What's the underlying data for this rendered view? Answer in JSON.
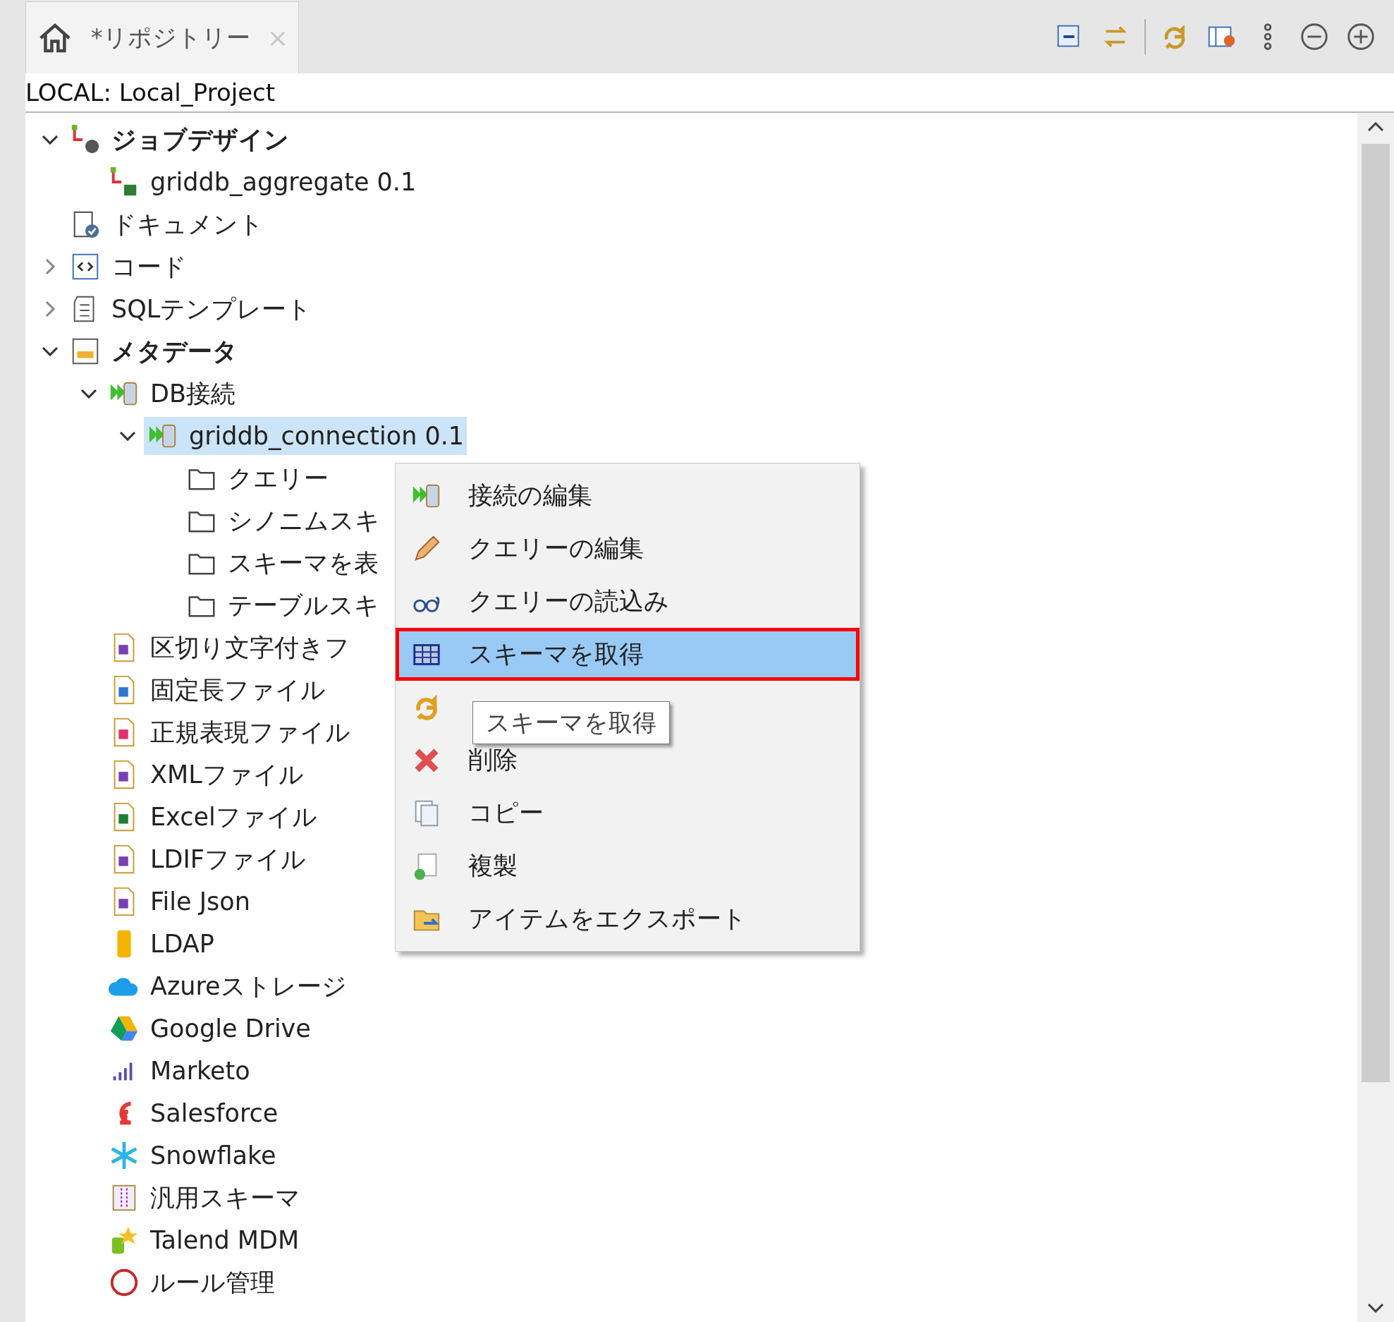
{
  "tab": {
    "title": "*リポジトリー",
    "close": "×"
  },
  "project": "LOCAL: Local_Project",
  "tree": [
    {
      "label": "ジョブデザイン",
      "bold": true,
      "expanded": true,
      "selected": false,
      "children": [
        {
          "label": "griddb_aggregate 0.1",
          "selected": false
        }
      ]
    },
    {
      "label": "ドキュメント",
      "bold": false,
      "selected": false
    },
    {
      "label": "コード",
      "bold": false,
      "expanded": false,
      "selected": false
    },
    {
      "label": "SQLテンプレート",
      "bold": false,
      "expanded": false,
      "selected": false
    },
    {
      "label": "メタデータ",
      "bold": true,
      "expanded": true,
      "selected": false,
      "children": [
        {
          "label": "DB接続",
          "expanded": true,
          "selected": false,
          "children": [
            {
              "label": "griddb_connection 0.1",
              "expanded": true,
              "selected": true,
              "children": [
                {
                  "label": "クエリー",
                  "selected": false
                },
                {
                  "label": "シノニムスキ",
                  "selected": false
                },
                {
                  "label": "スキーマを表",
                  "selected": false
                },
                {
                  "label": "テーブルスキ",
                  "selected": false
                }
              ]
            }
          ]
        },
        {
          "label": "区切り文字付きフ",
          "selected": false
        },
        {
          "label": "固定長ファイル",
          "selected": false
        },
        {
          "label": "正規表現ファイル",
          "selected": false
        },
        {
          "label": "XMLファイル",
          "selected": false
        },
        {
          "label": "Excelファイル",
          "selected": false
        },
        {
          "label": "LDIFファイル",
          "selected": false
        },
        {
          "label": "File Json",
          "selected": false
        },
        {
          "label": "LDAP",
          "selected": false
        },
        {
          "label": "Azureストレージ",
          "selected": false
        },
        {
          "label": "Google Drive",
          "selected": false
        },
        {
          "label": "Marketo",
          "selected": false
        },
        {
          "label": "Salesforce",
          "selected": false
        },
        {
          "label": "Snowflake",
          "selected": false
        },
        {
          "label": "汎用スキーマ",
          "selected": false
        },
        {
          "label": "Talend MDM",
          "selected": false
        },
        {
          "label": "ルール管理",
          "selected": false
        }
      ]
    }
  ],
  "menu": [
    {
      "label": "接続の編集",
      "selected": false
    },
    {
      "label": "クエリーの編集",
      "selected": false
    },
    {
      "label": "クエリーの読込み",
      "selected": false
    },
    {
      "label": "スキーマを取得",
      "selected": true
    },
    {
      "selected": false
    },
    {
      "label": "削除",
      "selected": false
    },
    {
      "label": "コピー",
      "selected": false
    },
    {
      "label": "複製",
      "selected": false
    },
    {
      "label": "アイテムをエクスポート",
      "selected": false
    }
  ],
  "tooltip": "スキーマを取得"
}
